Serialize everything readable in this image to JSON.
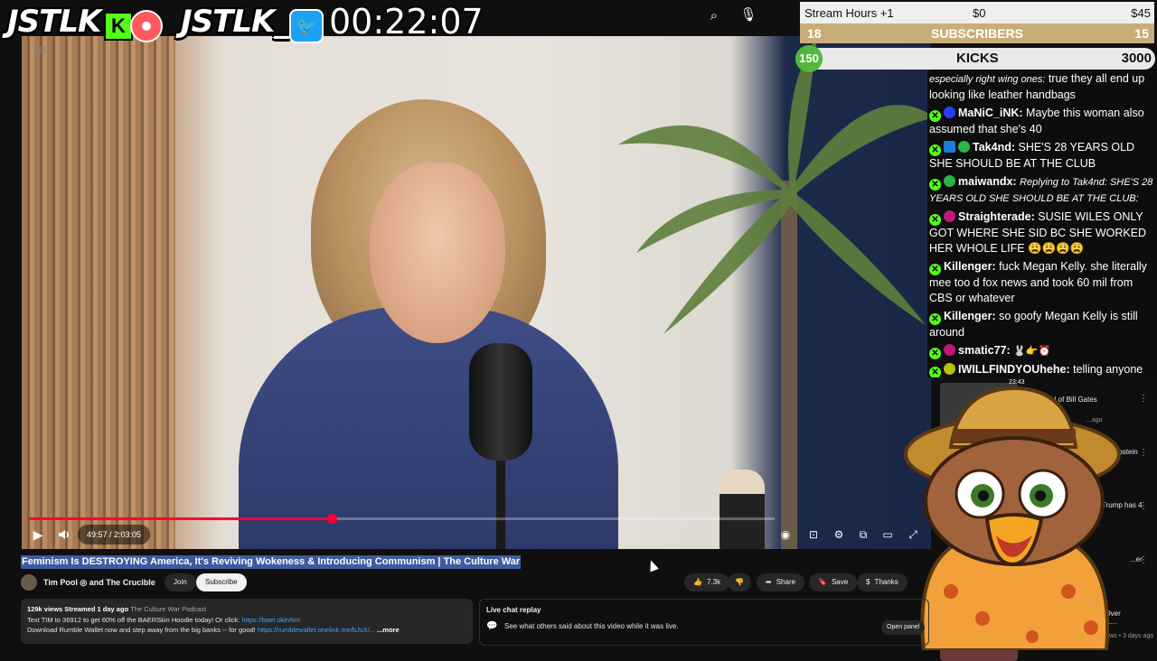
{
  "overlay": {
    "brand_left": "JSTLK",
    "kick_letter": "K",
    "brand_right": "JSTLK_",
    "timer": "00:22:07"
  },
  "goals": {
    "hours_label": "Stream Hours +1",
    "hours_current": "$0",
    "hours_target": "$45",
    "subs_current": "18",
    "subs_label": "SUBSCRIBERS",
    "subs_target": "15",
    "kicks_current": "150",
    "kicks_label": "KICKS",
    "kicks_target": "3000",
    "kicks_progress": 0.05
  },
  "chat": {
    "partial_top": "especially right wing ones:",
    "partial_top_text": "true they all end up looking like leather handbags",
    "messages": [
      {
        "user": "MaNiC_iNK:",
        "text": "Maybe this woman also assumed that she's 40",
        "color": "#2a3cff"
      },
      {
        "user": "Tak4nd:",
        "text": "SHE'S 28 YEARS OLD SHE SHOULD BE AT THE CLUB",
        "color": "#2ab54b"
      },
      {
        "user": "maiwandx:",
        "reply": "Replying to Tak4nd: SHE'S 28 YEARS OLD SHE SHOULD BE AT THE CLUB:",
        "color": "#2ab54b"
      },
      {
        "user": "Straighterade:",
        "text": "SUSIE WILES ONLY GOT WHERE SHE SID BC SHE WORKED HER WHOLE LIFE 😩😩😩😩",
        "color": "#c0177a"
      },
      {
        "user": "Killenger:",
        "text": "fuck Megan Kelly. she literally mee too d fox news and took 60 mil from CBS or whatever",
        "color": ""
      },
      {
        "user": "Killenger:",
        "text": "so goofy Megan Kelly is still around",
        "color": ""
      },
      {
        "user": "smatic77:",
        "text": "🐰👉⏰",
        "color": "#c0177a"
      },
      {
        "user": "IWILLFINDYOUhehe:",
        "text": "telling anyone to act anything is so weird",
        "color": "#b8c000"
      }
    ]
  },
  "player": {
    "time": "49:57 / 2:03:05",
    "progress": 0.406
  },
  "video": {
    "title": "Feminism Is DESTROYING America, It's Reviving Wokeness & Introducing Communism | The Culture War",
    "channel": "Tim Pool ◎ and The Crucible",
    "join": "Join",
    "subscribe": "Subscribe",
    "likes": "7.3k",
    "share": "Share",
    "save": "Save",
    "thanks": "Thanks"
  },
  "description": {
    "stats": "129k views  Streamed 1 day ago",
    "podcast": "The Culture War Podcast",
    "line1": "Text TIM to 36912 to get 60% off the BAERSkin Hoodie today! Or click:",
    "line1_link": "https://baer.skin/tim",
    "line2": "Download Rumble Wallet now and step away from the big banks -- for good!",
    "line2_link": "https://rumblewallet.onelink.me/bJsX/...",
    "more": "...more"
  },
  "live_chat": {
    "title": "Live chat replay",
    "text": "See what others said about this video while it was live.",
    "button": "Open panel"
  },
  "recommendations": [
    {
      "time": "23:43",
      "title": "...l of Bill Gates",
      "sub": "...ago"
    },
    {
      "title": "...om Epstein",
      "sub": ""
    },
    {
      "title": "...: Trump has 4",
      "sub": ""
    },
    {
      "title": "...er",
      "sub": ""
    },
    {
      "title": "...BLASTS Bill Over ...inkelstein ONL...",
      "sub": "Breaking Points ◎  502k views • 3 days ago"
    }
  ],
  "colors": {
    "kick_green": "#53fc18",
    "youtube_red": "#ff0033",
    "subs_gold": "#c9ad78"
  }
}
